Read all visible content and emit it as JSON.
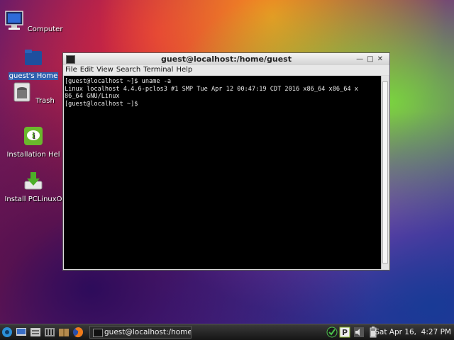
{
  "desktop": {
    "icons": [
      {
        "label": "Computer"
      },
      {
        "label": "guest's Home"
      },
      {
        "label": "Trash"
      },
      {
        "label": "Installation Hel"
      },
      {
        "label": "Install PCLinuxO"
      }
    ]
  },
  "window": {
    "title": "guest@localhost:/home/guest",
    "menu": [
      "File",
      "Edit",
      "View",
      "Search",
      "Terminal",
      "Help"
    ],
    "terminal_lines": [
      "[guest@localhost ~]$ uname -a",
      "Linux localhost 4.4.6-pclos3 #1 SMP Tue Apr 12 00:47:19 CDT 2016 x86_64 x86_64 x",
      "86_64 GNU/Linux",
      "[guest@localhost ~]$ "
    ]
  },
  "taskbar": {
    "task_label": "guest@localhost:/home...",
    "clock": "Sat Apr 16,  4:27 PM",
    "launchers": [
      "start-menu-icon",
      "show-desktop-icon",
      "file-manager-icon",
      "terminal-icon",
      "package-icon",
      "firefox-icon"
    ],
    "tray": [
      "update-check-icon",
      "pclinuxos-icon",
      "volume-icon",
      "battery-icon"
    ]
  }
}
